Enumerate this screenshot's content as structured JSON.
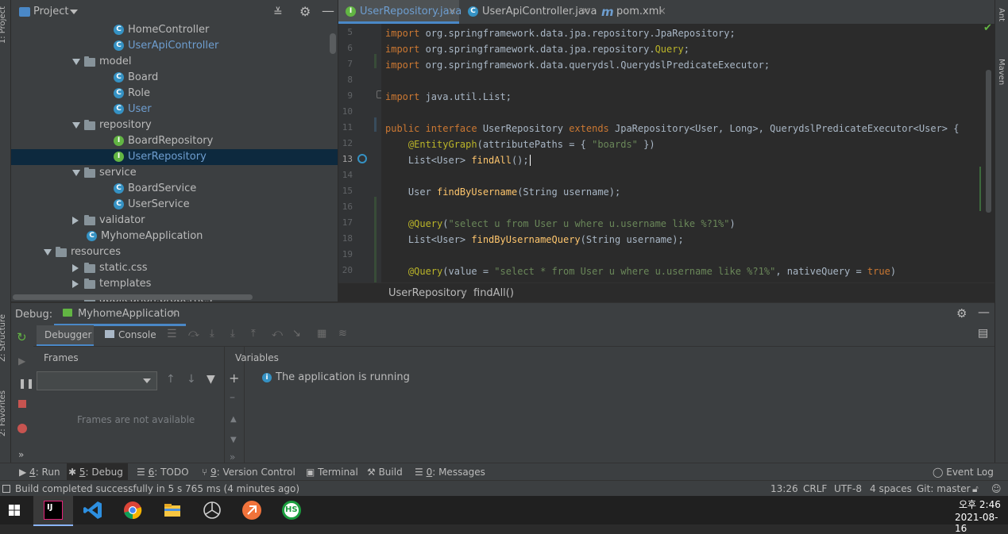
{
  "project": {
    "title": "Project",
    "tree": [
      {
        "label": "HomeController",
        "kind": "class",
        "indent": 3,
        "blue": false
      },
      {
        "label": "UserApiController",
        "kind": "class",
        "indent": 3,
        "blue": true
      },
      {
        "label": "model",
        "kind": "folder-open",
        "indent": 2
      },
      {
        "label": "Board",
        "kind": "class",
        "indent": 3,
        "blue": false
      },
      {
        "label": "Role",
        "kind": "class",
        "indent": 3,
        "blue": false
      },
      {
        "label": "User",
        "kind": "class",
        "indent": 3,
        "blue": true
      },
      {
        "label": "repository",
        "kind": "folder-open",
        "indent": 2
      },
      {
        "label": "BoardRepository",
        "kind": "interface",
        "indent": 3,
        "blue": false
      },
      {
        "label": "UserRepository",
        "kind": "interface",
        "indent": 3,
        "blue": true,
        "selected": true
      },
      {
        "label": "service",
        "kind": "folder-open",
        "indent": 2
      },
      {
        "label": "BoardService",
        "kind": "class",
        "indent": 3,
        "blue": false
      },
      {
        "label": "UserService",
        "kind": "class",
        "indent": 3,
        "blue": false
      },
      {
        "label": "validator",
        "kind": "folder-closed",
        "indent": 2
      },
      {
        "label": "MyhomeApplication",
        "kind": "class",
        "indent": 2,
        "blue": false
      },
      {
        "label": "resources",
        "kind": "folder-open",
        "indent": 1
      },
      {
        "label": "static.css",
        "kind": "folder-closed",
        "indent": 2
      },
      {
        "label": "templates",
        "kind": "folder-closed",
        "indent": 2
      },
      {
        "label": "application.properties",
        "kind": "file",
        "indent": 2
      }
    ]
  },
  "side_tabs": {
    "left": [
      "1: Project",
      "Z: Structure",
      "2: Favorites"
    ],
    "right": [
      "Ant",
      "Maven"
    ]
  },
  "editor": {
    "tabs": [
      {
        "label": "UserRepository.java",
        "icon": "interface-icon",
        "active": true
      },
      {
        "label": "UserApiController.java",
        "icon": "class-icon",
        "active": false
      },
      {
        "label": "pom.xml",
        "icon": "maven-icon",
        "active": false
      }
    ],
    "lines": [
      {
        "n": "5",
        "tokens": [
          [
            "kw",
            "import "
          ],
          [
            "",
            "org.springframework.data.jpa.repository.JpaRepository;"
          ]
        ]
      },
      {
        "n": "6",
        "tokens": [
          [
            "kw",
            "import "
          ],
          [
            "",
            "org.springframework.data.jpa.repository."
          ],
          [
            "an",
            "Query"
          ],
          [
            "",
            ";"
          ]
        ]
      },
      {
        "n": "7",
        "tokens": [
          [
            "kw",
            "import "
          ],
          [
            "",
            "org.springframework.data.querydsl.QuerydslPredicateExecutor;"
          ]
        ]
      },
      {
        "n": "8",
        "tokens": []
      },
      {
        "n": "9",
        "tokens": [
          [
            "kw",
            "import "
          ],
          [
            "",
            "java.util.List;"
          ]
        ]
      },
      {
        "n": "10",
        "tokens": []
      },
      {
        "n": "11",
        "tokens": [
          [
            "kw",
            "public interface "
          ],
          [
            "",
            "UserRepository "
          ],
          [
            "kw",
            "extends "
          ],
          [
            "",
            "JpaRepository<User, Long>, QuerydslPredicateExecutor<User> {"
          ]
        ]
      },
      {
        "n": "12",
        "tokens": [
          [
            "",
            "    "
          ],
          [
            "an",
            "@EntityGraph"
          ],
          [
            "",
            "(attributePaths = { "
          ],
          [
            "st",
            "\"boards\""
          ],
          [
            "",
            " })"
          ]
        ]
      },
      {
        "n": "13",
        "tokens": [
          [
            "",
            "    List<User> "
          ],
          [
            "fn",
            "findAll"
          ],
          [
            "",
            "();"
          ]
        ]
      },
      {
        "n": "14",
        "tokens": []
      },
      {
        "n": "15",
        "tokens": [
          [
            "",
            "    User "
          ],
          [
            "fn",
            "findByUsername"
          ],
          [
            "",
            "(String username);"
          ]
        ]
      },
      {
        "n": "16",
        "tokens": []
      },
      {
        "n": "17",
        "tokens": [
          [
            "",
            "    "
          ],
          [
            "an",
            "@Query"
          ],
          [
            "",
            "("
          ],
          [
            "st",
            "\"select u from User u where u.username like %?1%\""
          ],
          [
            "",
            ")"
          ]
        ]
      },
      {
        "n": "18",
        "tokens": [
          [
            "",
            "    List<User> "
          ],
          [
            "fn",
            "findByUsernameQuery"
          ],
          [
            "",
            "(String username);"
          ]
        ]
      },
      {
        "n": "19",
        "tokens": []
      },
      {
        "n": "20",
        "tokens": [
          [
            "",
            "    "
          ],
          [
            "an",
            "@Query"
          ],
          [
            "",
            "(value = "
          ],
          [
            "st",
            "\"select * from User u where u.username like %?1%\""
          ],
          [
            "",
            ", nativeQuery = "
          ],
          [
            "kw",
            "true"
          ],
          [
            "",
            ")"
          ]
        ]
      }
    ],
    "breadcrumb": [
      "UserRepository",
      "findAll()"
    ]
  },
  "debug": {
    "label": "Debug:",
    "config_tab": "MyhomeApplication",
    "subtabs": [
      "Debugger",
      "Console"
    ],
    "frames_header": "Frames",
    "frames_empty": "Frames are not available",
    "variables_header": "Variables",
    "running_message": "The application is running"
  },
  "bottom_tabs": [
    {
      "mnemonic": "4",
      "label": ": Run",
      "icon": "run-icon"
    },
    {
      "mnemonic": "5",
      "label": ": Debug",
      "icon": "bug-icon",
      "active": true
    },
    {
      "mnemonic": "6",
      "label": ": TODO",
      "icon": "list-icon"
    },
    {
      "mnemonic": "9",
      "label": ": Version Control",
      "icon": "vcs-icon"
    },
    {
      "mnemonic": "",
      "label": "Terminal",
      "icon": "terminal-icon"
    },
    {
      "mnemonic": "",
      "label": "Build",
      "icon": "hammer-icon"
    },
    {
      "mnemonic": "0",
      "label": ": Messages",
      "icon": "messages-icon"
    }
  ],
  "event_log": "Event Log",
  "status": {
    "message": "Build completed successfully in 5 s 765 ms (4 minutes ago)",
    "position": "13:26",
    "line_sep": "CRLF",
    "encoding": "UTF-8",
    "indent": "4 spaces",
    "git": "Git: master"
  },
  "taskbar": {
    "time": "오후 2:46",
    "date": "2021-08-16",
    "apps": [
      "windows-icon",
      "intellij-icon",
      "vscode-icon",
      "chrome-icon",
      "explorer-icon",
      "app5-icon",
      "app6-icon",
      "hs-icon"
    ],
    "hs_label": "HS",
    "ij_label": "IJ"
  },
  "colors": {
    "accent": "#4a88c7",
    "selection": "#0d293e",
    "keyword": "#cc7832",
    "annotation": "#bbb529",
    "string": "#6a8759",
    "function": "#ffc66d"
  }
}
